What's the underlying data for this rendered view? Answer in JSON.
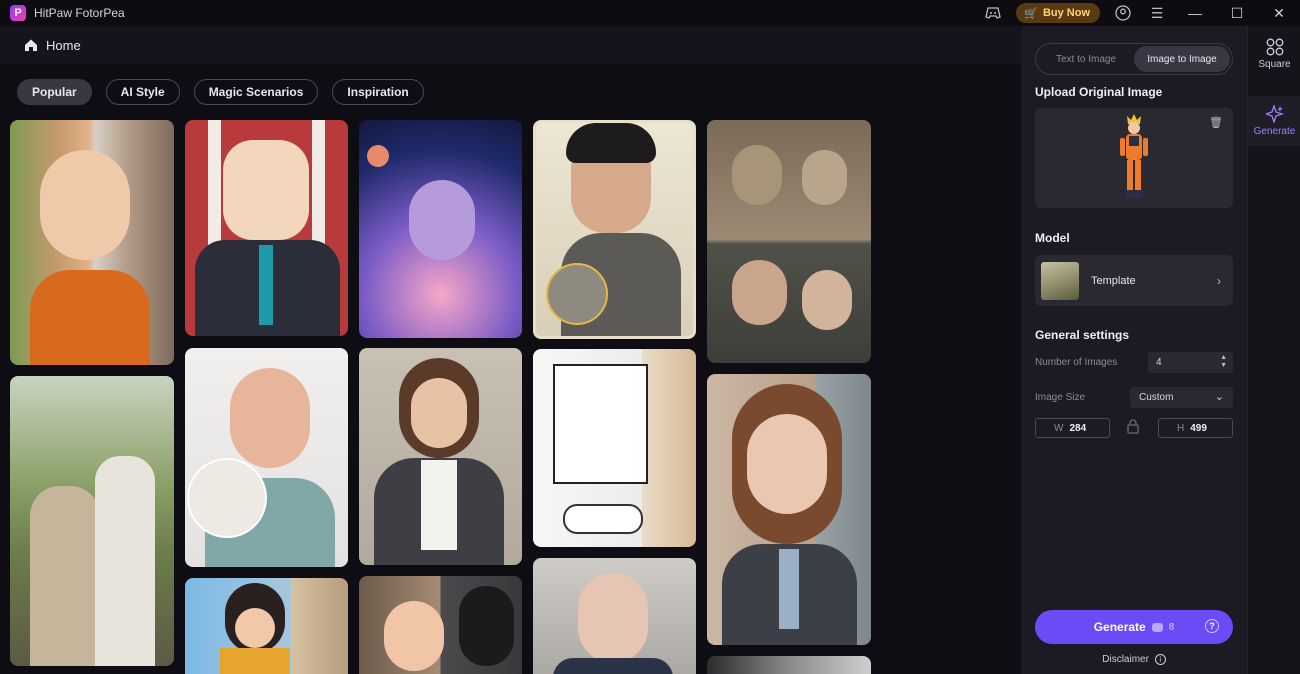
{
  "app": {
    "title": "HitPaw FotorPea",
    "logo_letter": "P"
  },
  "titlebar": {
    "buy_label": "Buy Now"
  },
  "subheader": {
    "home_label": "Home"
  },
  "filters": [
    "Popular",
    "AI Style",
    "Magic Scenarios",
    "Inspiration"
  ],
  "panel": {
    "modes": [
      "Text to Image",
      "Image to Image"
    ],
    "upload_title": "Upload Original Image",
    "model_title": "Model",
    "model_name": "Template",
    "general_title": "General settings",
    "num_images_label": "Number of Images",
    "num_images_value": "4",
    "image_size_label": "Image Size",
    "image_size_value": "Custom",
    "width_label": "W",
    "width_value": "284",
    "height_label": "H",
    "height_value": "499",
    "generate_label": "Generate",
    "generate_credit": "8",
    "disclaimer_label": "Disclaimer"
  },
  "rail": {
    "square_label": "Square",
    "generate_label": "Generate"
  },
  "colors": {
    "accent": "#6a4bf5",
    "rail_active": "#9b80ff",
    "buy_now": "#ffd27a"
  }
}
